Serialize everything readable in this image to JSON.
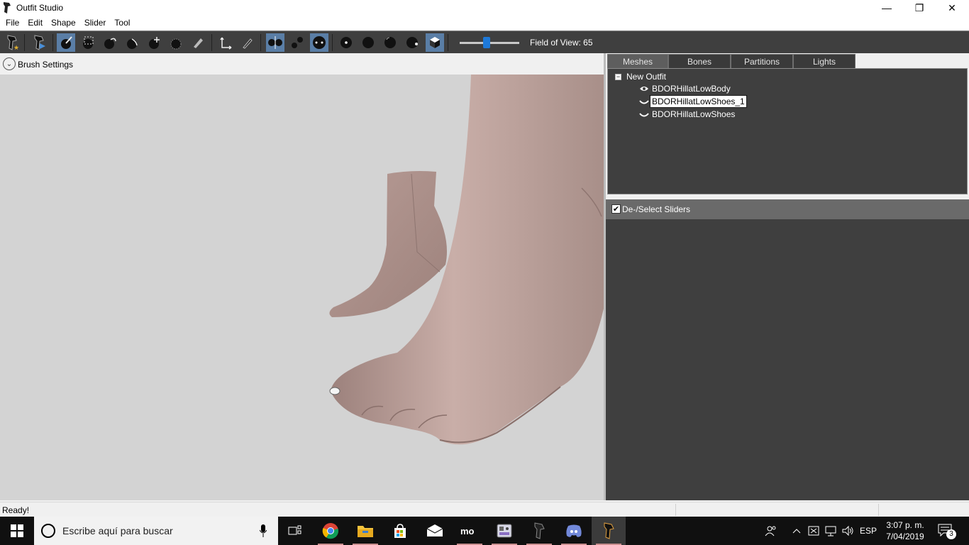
{
  "window": {
    "title": "Outfit Studio",
    "controls": {
      "minimize": "—",
      "maximize": "❐",
      "close": "✕"
    }
  },
  "menu": [
    "File",
    "Edit",
    "Shape",
    "Slider",
    "Tool"
  ],
  "toolbar": {
    "tools": [
      {
        "name": "new-outfit-icon"
      },
      {
        "name": "load-reference-icon"
      },
      {
        "name": "select-brush-icon",
        "active": true
      },
      {
        "name": "mask-brush-icon"
      },
      {
        "name": "inflate-brush-icon"
      },
      {
        "name": "deflate-brush-icon"
      },
      {
        "name": "move-brush-icon"
      },
      {
        "name": "smooth-brush-icon"
      },
      {
        "name": "weight-brush-icon"
      },
      {
        "name": "transform-icon"
      },
      {
        "name": "pen-icon"
      },
      {
        "name": "xmirror-icon",
        "active": true
      },
      {
        "name": "connected-icon"
      },
      {
        "name": "global-brush-icon",
        "active": true
      },
      {
        "name": "vertex-view-icon"
      },
      {
        "name": "wireframe-view-icon"
      },
      {
        "name": "lighting-view-icon"
      },
      {
        "name": "texture-view-icon"
      },
      {
        "name": "color-view-icon",
        "active": true
      }
    ],
    "fov_label": "Field of View: 65",
    "fov_value": 65
  },
  "brush": {
    "label": "Brush Settings"
  },
  "panel": {
    "tabs": [
      {
        "label": "Meshes",
        "active": true
      },
      {
        "label": "Bones",
        "active": false
      },
      {
        "label": "Partitions",
        "active": false
      },
      {
        "label": "Lights",
        "active": false
      }
    ],
    "tree_root": "New Outfit",
    "meshes": [
      {
        "label": "BDORHillatLowBody",
        "icon": "eye-icon",
        "selected": false
      },
      {
        "label": "BDORHillatLowShoes_1",
        "icon": "shape-icon",
        "selected": true
      },
      {
        "label": "BDORHillatLowShoes",
        "icon": "shape-icon",
        "selected": false
      }
    ],
    "sliders_label": "De-/Select Sliders",
    "sliders_checked": true
  },
  "status": {
    "text": "Ready!"
  },
  "taskbar": {
    "search_placeholder": "Escribe aquí para buscar",
    "language": "ESP",
    "time": "3:07 p. m.",
    "date": "7/04/2019",
    "notifications": "3"
  }
}
